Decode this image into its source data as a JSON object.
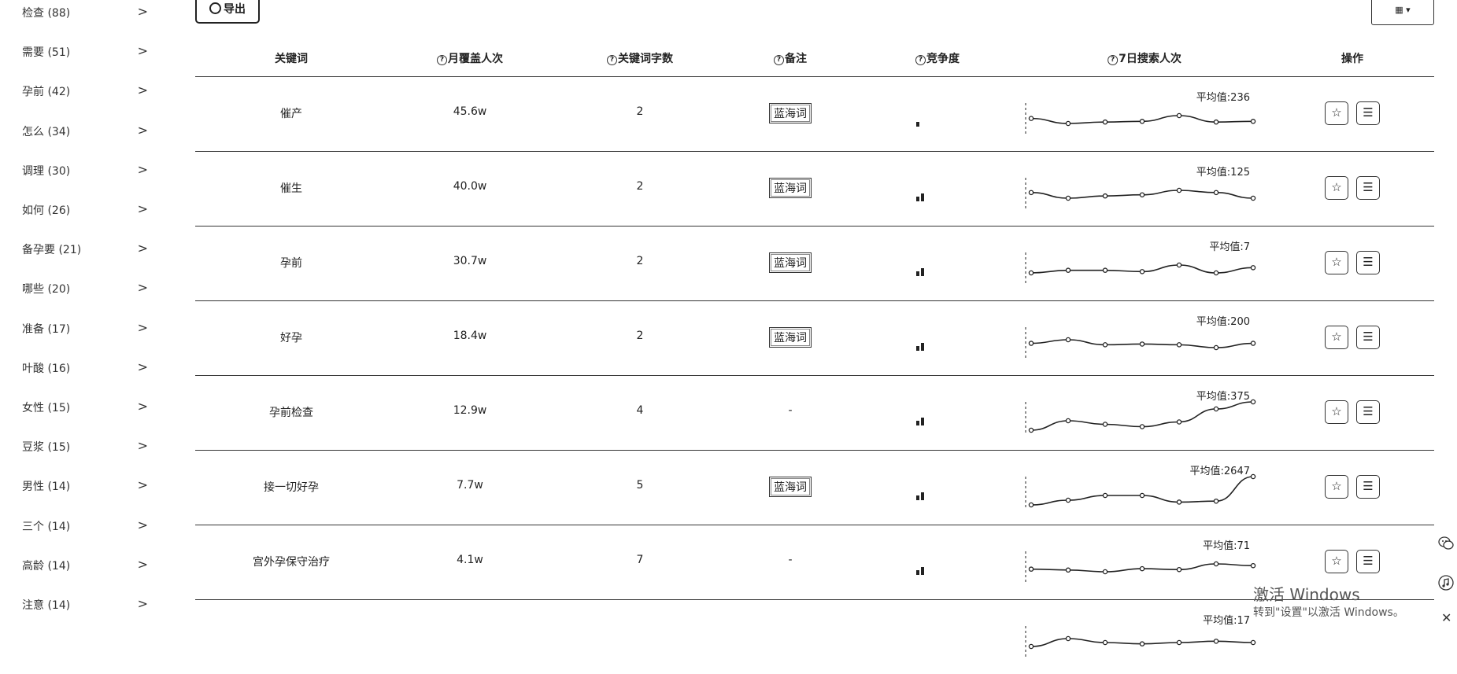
{
  "sidebar": {
    "items": [
      {
        "label": "检查  (88)"
      },
      {
        "label": "需要  (51)"
      },
      {
        "label": "孕前  (42)"
      },
      {
        "label": "怎么  (34)"
      },
      {
        "label": "调理  (30)"
      },
      {
        "label": "如何  (26)"
      },
      {
        "label": "备孕要  (21)"
      },
      {
        "label": "哪些  (20)"
      },
      {
        "label": "准备  (17)"
      },
      {
        "label": "叶酸  (16)"
      },
      {
        "label": "女性  (15)"
      },
      {
        "label": "豆浆  (15)"
      },
      {
        "label": "男性  (14)"
      },
      {
        "label": "三个  (14)"
      },
      {
        "label": "高龄  (14)"
      },
      {
        "label": "注意  (14)"
      }
    ],
    "chevron": ">"
  },
  "toolbar": {
    "export_label": "导出",
    "grid_label": "▦ ▾"
  },
  "table": {
    "headers": {
      "keyword": "关键词",
      "monthly": "月覆盖人次",
      "chars": "关键词字数",
      "remark": "备注",
      "competition": "竞争度",
      "trend": "7日搜索人次",
      "actions": "操作"
    },
    "help_glyph": "?",
    "rows": [
      {
        "keyword": "催产",
        "monthly": "45.6w",
        "chars": "2",
        "remark": "蓝海词",
        "competition": 1,
        "avg": "平均值:236",
        "trend": [
          236,
          229,
          231,
          232,
          240,
          231,
          232
        ]
      },
      {
        "keyword": "催生",
        "monthly": "40.0w",
        "chars": "2",
        "remark": "蓝海词",
        "competition": 2,
        "avg": "平均值:125",
        "trend": [
          127,
          122,
          124,
          125,
          129,
          127,
          122
        ]
      },
      {
        "keyword": "孕前",
        "monthly": "30.7w",
        "chars": "2",
        "remark": "蓝海词",
        "competition": 2,
        "avg": "平均值:7",
        "trend": [
          5,
          7,
          7,
          6,
          11,
          5,
          9
        ]
      },
      {
        "keyword": "好孕",
        "monthly": "18.4w",
        "chars": "2",
        "remark": "蓝海词",
        "competition": 2,
        "avg": "平均值:200",
        "trend": [
          200,
          205,
          198,
          199,
          198,
          194,
          200
        ]
      },
      {
        "keyword": "孕前检查",
        "monthly": "12.9w",
        "chars": "4",
        "remark": "-",
        "competition": 2,
        "avg": "平均值:375",
        "trend": [
          363,
          371,
          368,
          366,
          370,
          381,
          387
        ]
      },
      {
        "keyword": "接一切好孕",
        "monthly": "7.7w",
        "chars": "5",
        "remark": "蓝海词",
        "competition": 2,
        "avg": "平均值:2647",
        "trend": [
          2500,
          2550,
          2600,
          2600,
          2530,
          2540,
          2800
        ]
      },
      {
        "keyword": "宫外孕保守治疗",
        "monthly": "4.1w",
        "chars": "7",
        "remark": "-",
        "competition": 2,
        "avg": "平均值:71",
        "trend": [
          68,
          66,
          62,
          69,
          67,
          80,
          76
        ]
      },
      {
        "keyword": "",
        "monthly": "",
        "chars": "",
        "remark": "",
        "competition": 0,
        "avg": "平均值:17",
        "trend": [
          14,
          20,
          17,
          16,
          17,
          18,
          17
        ]
      }
    ],
    "action_icons": [
      "star-icon",
      "list-icon"
    ]
  },
  "watermark": {
    "title": "激活 Windows",
    "subtitle": "转到\"设置\"以激活 Windows。"
  },
  "side_icons": [
    "wechat-icon",
    "music-icon"
  ],
  "colors": {
    "line": "#222222",
    "border": "#333333"
  }
}
